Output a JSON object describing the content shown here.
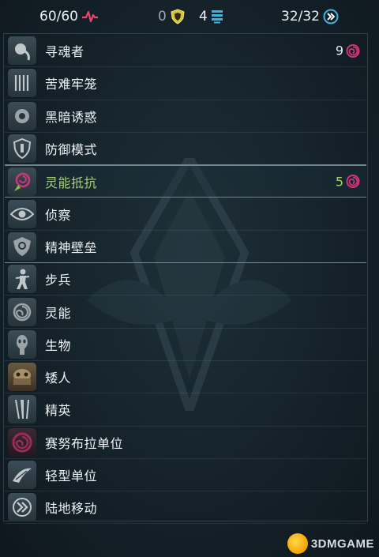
{
  "header": {
    "hp": "60/60",
    "armor": "0",
    "shield": "4",
    "speed": "32/32"
  },
  "keywords": [
    {
      "label": "寻魂者",
      "icon": "soul-seeker-icon",
      "value": "9"
    },
    {
      "label": "苦难牢笼",
      "icon": "cage-icon"
    },
    {
      "label": "黑暗诱惑",
      "icon": "dark-lure-icon"
    },
    {
      "label": "防御模式",
      "icon": "defense-mode-icon"
    },
    {
      "label": "灵能抵抗",
      "icon": "psychic-resist-icon",
      "value": "5"
    },
    {
      "label": "侦察",
      "icon": "eye-icon"
    },
    {
      "label": "精神壁垒",
      "icon": "mind-barrier-icon"
    },
    {
      "label": "步兵",
      "icon": "infantry-icon"
    },
    {
      "label": "灵能",
      "icon": "psychic-icon"
    },
    {
      "label": "生物",
      "icon": "biological-icon"
    },
    {
      "label": "矮人",
      "icon": "dwarf-icon"
    },
    {
      "label": "精英",
      "icon": "elite-icon"
    },
    {
      "label": "赛努布拉单位",
      "icon": "cenobula-icon"
    },
    {
      "label": "轻型单位",
      "icon": "light-unit-icon"
    },
    {
      "label": "陆地移动",
      "icon": "ground-move-icon"
    }
  ],
  "colors": {
    "hp_accent": "#e9486a",
    "armor_accent": "#e8d84a",
    "shield_accent": "#3fb2e0",
    "speed_accent": "#3fb2e0",
    "psychic_accent": "#d0357a",
    "selected_text": "#a4d26a"
  },
  "watermark": "3DMGAME"
}
